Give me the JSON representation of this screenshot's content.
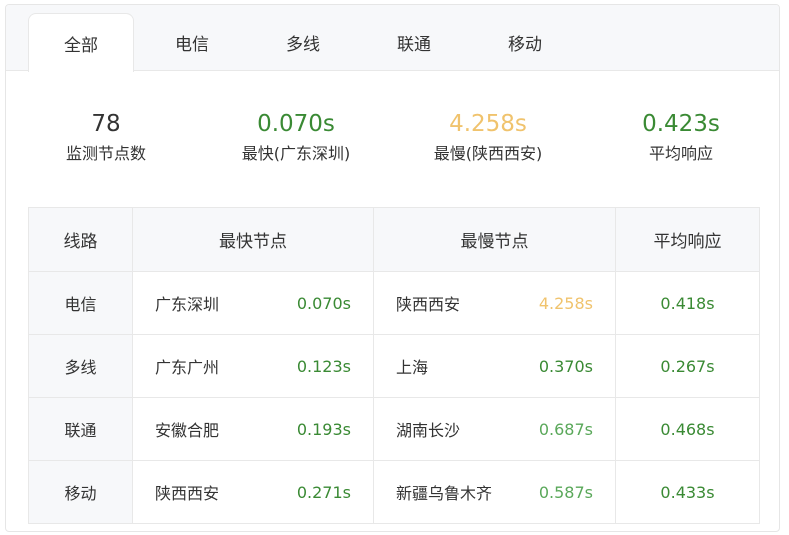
{
  "tabs": [
    "全部",
    "电信",
    "多线",
    "联通",
    "移动"
  ],
  "active_tab": 0,
  "stats": [
    {
      "value": "78",
      "label": "监测节点数",
      "color": "#333333"
    },
    {
      "value": "0.070s",
      "label": "最快(广东深圳)",
      "color": "#3a8a34"
    },
    {
      "value": "4.258s",
      "label": "最慢(陕西西安)",
      "color": "#f0c36d"
    },
    {
      "value": "0.423s",
      "label": "平均响应",
      "color": "#3a8a34"
    }
  ],
  "table": {
    "headers": {
      "line": "线路",
      "fastest": "最快节点",
      "slowest": "最慢节点",
      "avg": "平均响应"
    },
    "rows": [
      {
        "line": "电信",
        "fast_node": "广东深圳",
        "fast_time": "0.070s",
        "slow_node": "陕西西安",
        "slow_time": "4.258s",
        "avg": "0.418s"
      },
      {
        "line": "多线",
        "fast_node": "广东广州",
        "fast_time": "0.123s",
        "slow_node": "上海",
        "slow_time": "0.370s",
        "avg": "0.267s"
      },
      {
        "line": "联通",
        "fast_node": "安徽合肥",
        "fast_time": "0.193s",
        "slow_node": "湖南长沙",
        "slow_time": "0.687s",
        "avg": "0.468s"
      },
      {
        "line": "移动",
        "fast_node": "陕西西安",
        "fast_time": "0.271s",
        "slow_node": "新疆乌鲁木齐",
        "slow_time": "0.587s",
        "avg": "0.433s"
      }
    ]
  },
  "colors": {
    "green": "#3a8a34",
    "light_green": "#5aa85a",
    "orange": "#f0c36d",
    "text": "#333333",
    "header_bg": "#f7f8fa",
    "border": "#e8e8e8"
  }
}
